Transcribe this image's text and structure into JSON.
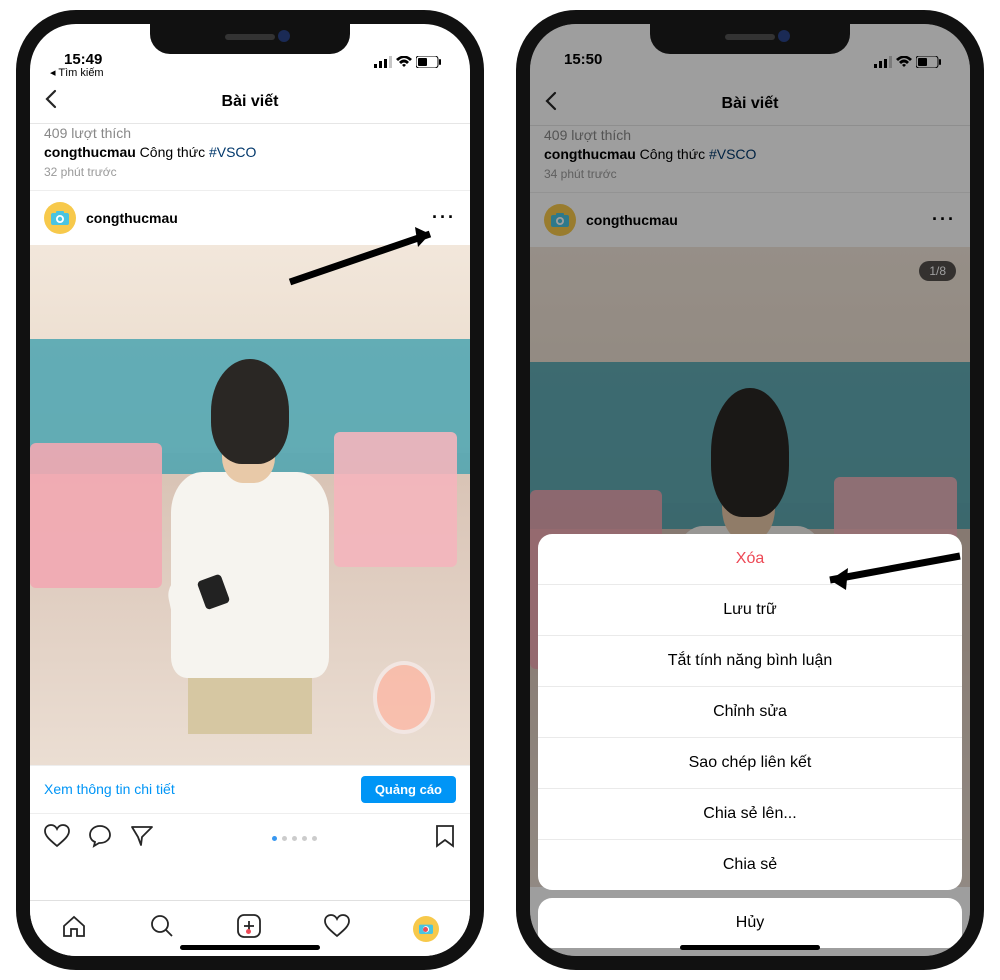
{
  "left": {
    "status_time": "15:49",
    "back_to": "◂ Tìm kiếm",
    "header_title": "Bài viết",
    "prev_likes": "409 lượt thích",
    "prev_user": "congthucmau",
    "prev_caption": "Công thức",
    "prev_hashtag": "#VSCO",
    "prev_time": "32 phút trước",
    "username": "congthucmau",
    "promo_link": "Xem thông tin chi tiết",
    "promo_btn": "Quảng cáo"
  },
  "right": {
    "status_time": "15:50",
    "header_title": "Bài viết",
    "prev_likes": "409 lượt thích",
    "prev_user": "congthucmau",
    "prev_caption": "Công thức",
    "prev_hashtag": "#VSCO",
    "prev_time": "34 phút trước",
    "username": "congthucmau",
    "carousel_badge": "1/8",
    "sheet": {
      "delete": "Xóa",
      "archive": "Lưu trữ",
      "comments_off": "Tắt tính năng bình luận",
      "edit": "Chỉnh sửa",
      "copy_link": "Sao chép liên kết",
      "share_to": "Chia sẻ lên...",
      "share": "Chia sẻ",
      "cancel": "Hủy"
    }
  }
}
